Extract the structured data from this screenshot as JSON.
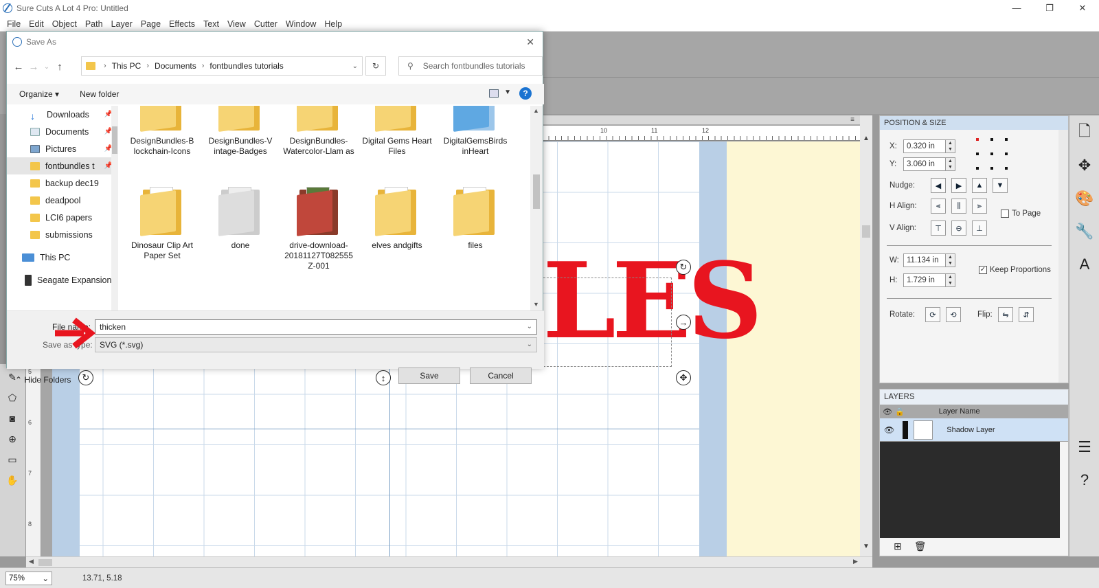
{
  "app": {
    "title": "Sure Cuts A Lot 4 Pro: Untitled",
    "window_controls": [
      "—",
      "❐",
      "✕"
    ]
  },
  "menu": [
    "File",
    "Edit",
    "Object",
    "Path",
    "Layer",
    "Page",
    "Effects",
    "Text",
    "View",
    "Cutter",
    "Window",
    "Help"
  ],
  "dialog": {
    "title": "Save As",
    "close": "✕",
    "breadcrumb": [
      "This PC",
      "Documents",
      "fontbundles tutorials"
    ],
    "search_placeholder": "Search fontbundles tutorials",
    "organize": "Organize ▾",
    "new_folder": "New folder",
    "help": "?",
    "nav_items": [
      {
        "label": "Downloads",
        "icon": "download-arrow-icon",
        "pinned": true
      },
      {
        "label": "Documents",
        "icon": "documents-icon",
        "pinned": true
      },
      {
        "label": "Pictures",
        "icon": "pictures-icon",
        "pinned": true
      },
      {
        "label": "fontbundles t",
        "icon": "folder-icon",
        "pinned": true,
        "selected": true
      },
      {
        "label": "backup dec19",
        "icon": "folder-icon"
      },
      {
        "label": "deadpool",
        "icon": "folder-icon"
      },
      {
        "label": "LCI6 papers",
        "icon": "folder-icon"
      },
      {
        "label": "submissions",
        "icon": "folder-icon"
      },
      {
        "label": "This PC",
        "icon": "computer-icon"
      },
      {
        "label": "Seagate Expansion",
        "icon": "drive-icon"
      }
    ],
    "files": [
      "DesignBundles-B lockchain-Icons",
      "DesignBundles-V intage-Badges",
      "DesignBundles- Watercolor-Llam as",
      "Digital Gems Heart Files",
      "DigitalGemsBirds inHeart",
      "Dinosaur Clip Art Paper Set",
      "done",
      "drive-download- 20181127T082555 Z-001",
      "elves andgifts",
      "files"
    ],
    "file_name_label": "File name:",
    "file_name_value": "thicken",
    "save_type_label": "Save as type:",
    "save_type_value": "SVG (*.svg)",
    "hide_folders": "Hide Folders",
    "save": "Save",
    "cancel": "Cancel"
  },
  "ruler": {
    "h_ticks": [
      "10",
      "11",
      "12"
    ],
    "v_ticks": [
      "5",
      "6",
      "7",
      "8"
    ]
  },
  "canvas": {
    "text": "LES",
    "text_color": "#e8151f"
  },
  "position_size": {
    "header": "POSITION & SIZE",
    "x_label": "X:",
    "x_value": "0.320 in",
    "y_label": "Y:",
    "y_value": "3.060 in",
    "nudge_label": "Nudge:",
    "halign_label": "H Align:",
    "valign_label": "V Align:",
    "to_page": "To Page",
    "w_label": "W:",
    "w_value": "11.134 in",
    "h_label": "H:",
    "h_value": "1.729 in",
    "keep_proportions": "Keep Proportions",
    "rotate_label": "Rotate:",
    "flip_label": "Flip:"
  },
  "layers": {
    "header": "LAYERS",
    "column": "Layer Name",
    "rows": [
      {
        "name": "Shadow Layer"
      }
    ]
  },
  "status": {
    "zoom": "75%",
    "coords": "13.71, 5.18"
  }
}
